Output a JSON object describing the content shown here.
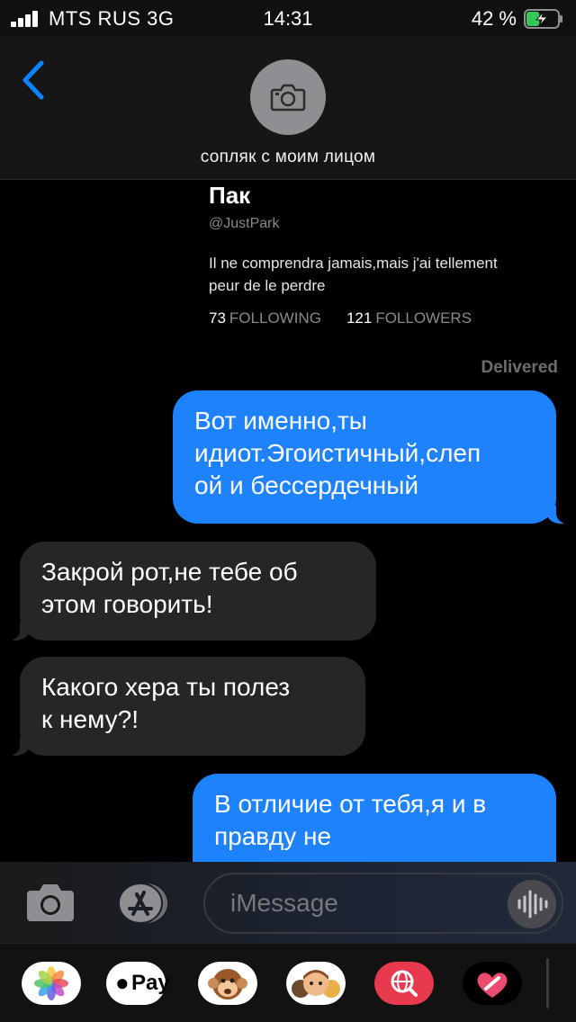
{
  "status_bar": {
    "carrier": "MTS RUS  3G",
    "time": "14:31",
    "battery": "42 %",
    "battery_level": 0.42
  },
  "header": {
    "back_icon": "chevron-left-icon",
    "avatar_icon": "camera-icon",
    "contact_name": "сопляк с моим лицом"
  },
  "profile": {
    "name": "Пак",
    "handle": "@JustPark",
    "bio_line1": "Il ne comprendra jamais,mais j'ai tellement",
    "bio_line2": "peur de le perdre",
    "following_count": "73",
    "following_label": "FOLLOWING",
    "followers_count": "121",
    "followers_label": "FOLLOWERS"
  },
  "delivered_label": "Delivered",
  "messages": [
    {
      "direction": "outgoing",
      "lines": [
        "Вот именно,ты",
        "идиот.Эгоистичный,слеп",
        "ой и бессердечный"
      ]
    },
    {
      "direction": "incoming",
      "lines": [
        "Закрой рот,не тебе об",
        "этом говорить!"
      ]
    },
    {
      "direction": "incoming",
      "lines": [
        "Какого хера ты полез",
        "к нему?!"
      ]
    },
    {
      "direction": "outgoing",
      "lines": [
        "В отличие от тебя,я и в",
        "правду не"
      ]
    }
  ],
  "input": {
    "placeholder": "iMessage",
    "camera_icon": "camera-icon",
    "apps_icon": "app-store-icon",
    "audio_icon": "audio-waveform-icon"
  },
  "app_drawer": {
    "apps": [
      "photos-icon",
      "apple-pay-icon",
      "monkey-animoji-icon",
      "memoji-icon",
      "web-search-icon",
      "digital-touch-icon"
    ],
    "apple_pay_label": "Pay"
  },
  "colors": {
    "outgoing_bubble": "#1d82fb",
    "incoming_bubble": "#262628",
    "accent": "#0a84ff",
    "battery_fill": "#34c759"
  }
}
